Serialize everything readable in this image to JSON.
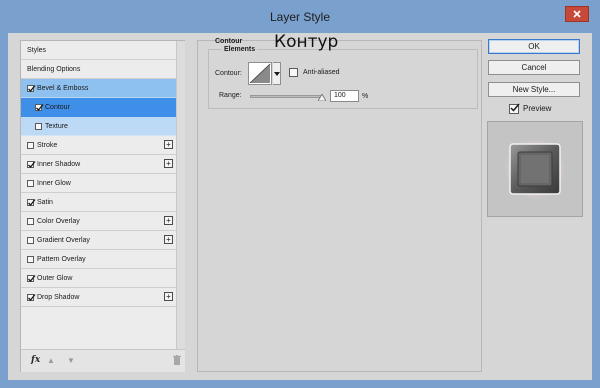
{
  "window": {
    "title": "Layer Style"
  },
  "sidebar": {
    "items": [
      {
        "label": "Styles",
        "checkbox": false,
        "checked": false,
        "plus": false,
        "state": "normal",
        "indent": 0
      },
      {
        "label": "Blending Options",
        "checkbox": false,
        "checked": false,
        "plus": false,
        "state": "normal",
        "indent": 0
      },
      {
        "label": "Bevel & Emboss",
        "checkbox": true,
        "checked": true,
        "plus": false,
        "state": "parent-selected",
        "indent": 0
      },
      {
        "label": "Contour",
        "checkbox": true,
        "checked": true,
        "plus": false,
        "state": "selected",
        "indent": 1
      },
      {
        "label": "Texture",
        "checkbox": true,
        "checked": false,
        "plus": false,
        "state": "parent-selected-light",
        "indent": 1
      },
      {
        "label": "Stroke",
        "checkbox": true,
        "checked": false,
        "plus": true,
        "state": "normal",
        "indent": 0
      },
      {
        "label": "Inner Shadow",
        "checkbox": true,
        "checked": true,
        "plus": true,
        "state": "normal",
        "indent": 0
      },
      {
        "label": "Inner Glow",
        "checkbox": true,
        "checked": false,
        "plus": false,
        "state": "normal",
        "indent": 0
      },
      {
        "label": "Satin",
        "checkbox": true,
        "checked": true,
        "plus": false,
        "state": "normal",
        "indent": 0
      },
      {
        "label": "Color Overlay",
        "checkbox": true,
        "checked": false,
        "plus": true,
        "state": "normal",
        "indent": 0
      },
      {
        "label": "Gradient Overlay",
        "checkbox": true,
        "checked": false,
        "plus": true,
        "state": "normal",
        "indent": 0
      },
      {
        "label": "Pattern Overlay",
        "checkbox": true,
        "checked": false,
        "plus": false,
        "state": "normal",
        "indent": 0
      },
      {
        "label": "Outer Glow",
        "checkbox": true,
        "checked": true,
        "plus": false,
        "state": "normal",
        "indent": 0
      },
      {
        "label": "Drop Shadow",
        "checkbox": true,
        "checked": true,
        "plus": true,
        "state": "normal",
        "indent": 0
      }
    ],
    "bottom": {
      "fx_label": "fx",
      "icons": [
        "fx-icon",
        "move-up-icon",
        "move-down-icon",
        "trash-icon"
      ]
    }
  },
  "contour_panel": {
    "heading": "Contour",
    "subheading": "Elements",
    "overlay_word": "Контур",
    "contour_label": "Contour:",
    "anti_aliased_label": "Anti-aliased",
    "anti_aliased_checked": false,
    "range_label": "Range:",
    "range_value": "100",
    "range_unit": "%",
    "range_level_fraction": 1.0
  },
  "actions": {
    "ok_label": "OK",
    "cancel_label": "Cancel",
    "new_style_label": "New Style...",
    "preview_label": "Preview",
    "preview_checked": true
  },
  "colors": {
    "titlebar": "#7aa0cd",
    "selected_row": "#3f8fe8",
    "parent_row": "#8ec1f0",
    "close_button": "#c7493a"
  }
}
